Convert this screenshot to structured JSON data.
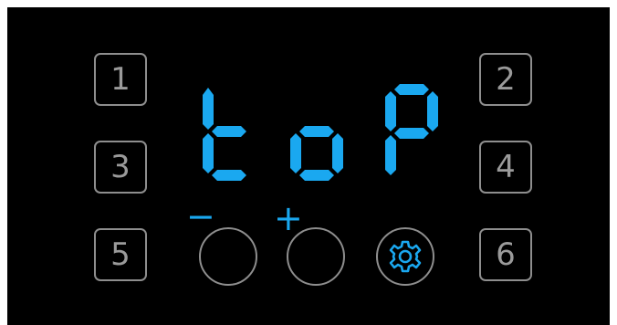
{
  "display": {
    "text": "toP",
    "color": "#1aa8f0"
  },
  "buttons": {
    "b1": "1",
    "b2": "2",
    "b3": "3",
    "b4": "4",
    "b5": "5",
    "b6": "6"
  },
  "controls": {
    "minus_symbol": "−",
    "plus_symbol": "+",
    "settings_icon": "gear-icon"
  },
  "colors": {
    "panel": "#000000",
    "outline": "#8e8e8e",
    "accent": "#1aa8f0"
  }
}
